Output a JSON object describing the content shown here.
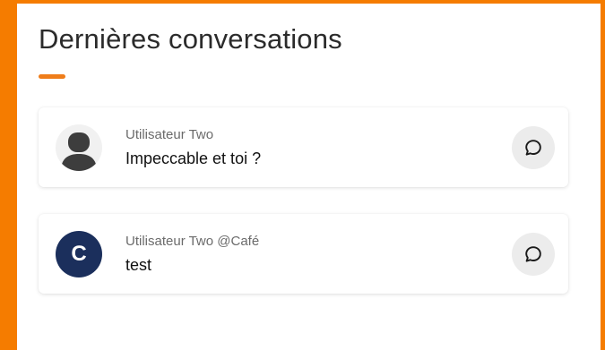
{
  "section": {
    "title": "Dernières conversations",
    "accent_color": "#ef7d1a"
  },
  "frame_color": "#f57c00",
  "conversations": [
    {
      "sender": "Utilisateur Two",
      "message": "Impeccable et toi ?",
      "avatar_type": "generic-person",
      "action_icon": "chat-bubble-icon"
    },
    {
      "sender": "Utilisateur Two @Café",
      "message": "test",
      "avatar_type": "letter",
      "avatar_letter": "C",
      "avatar_color": "#1b2f5c",
      "action_icon": "chat-bubble-icon"
    }
  ]
}
